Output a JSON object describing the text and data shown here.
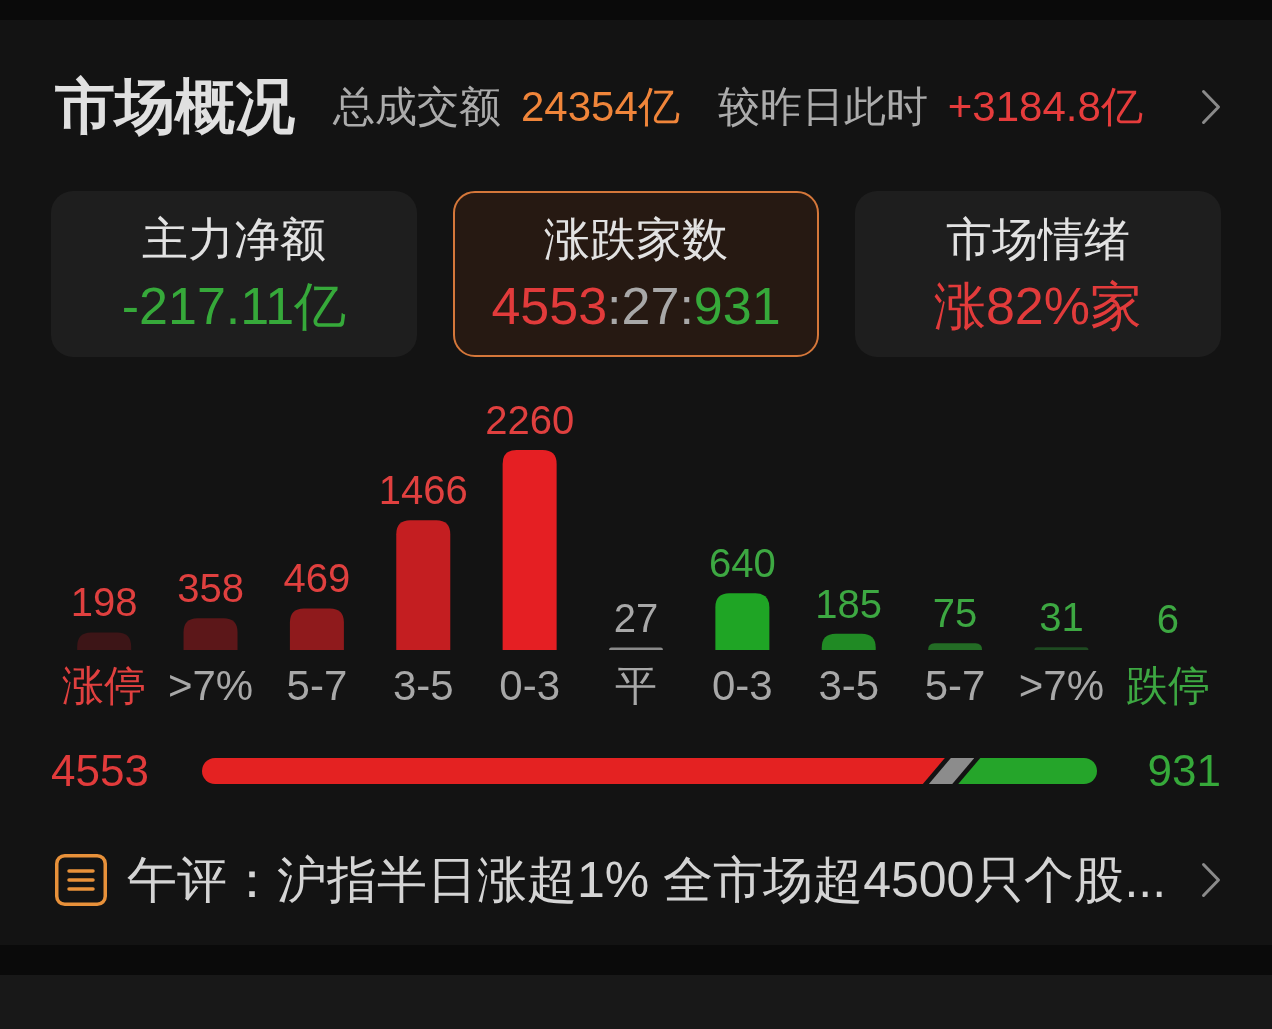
{
  "header": {
    "title": "市场概况",
    "items": [
      {
        "kind": "label",
        "text": "总成交额"
      },
      {
        "kind": "amount",
        "text": "24354亿"
      },
      {
        "kind": "label",
        "text": "较昨日此时"
      },
      {
        "kind": "up",
        "text": "+3184.8亿"
      }
    ]
  },
  "cards": [
    {
      "title": "主力净额",
      "selected": false,
      "value_parts": [
        {
          "kind": "down",
          "text": "-217.11亿"
        }
      ]
    },
    {
      "title": "涨跌家数",
      "selected": true,
      "value_parts": [
        {
          "kind": "up",
          "text": "4553"
        },
        {
          "kind": "sep",
          "text": ":"
        },
        {
          "kind": "flat",
          "text": "27"
        },
        {
          "kind": "sep",
          "text": ":"
        },
        {
          "kind": "down",
          "text": "931"
        }
      ]
    },
    {
      "title": "市场情绪",
      "selected": false,
      "value_parts": [
        {
          "kind": "up",
          "text": "涨82%家"
        }
      ]
    }
  ],
  "distribution": {
    "chart_data": {
      "type": "bar",
      "categories": [
        "涨停",
        ">7%",
        "5-7",
        "3-5",
        "0-3",
        "平",
        "0-3",
        "3-5",
        "5-7",
        ">7%",
        "跌停"
      ],
      "values": [
        198,
        358,
        469,
        1466,
        2260,
        27,
        640,
        185,
        75,
        31,
        6
      ],
      "data_labels": true
    },
    "bars": [
      {
        "kind": "limit_up",
        "color": "#3d1517"
      },
      {
        "kind": "up",
        "color": "#5c1719"
      },
      {
        "kind": "up",
        "color": "#8f1a1c"
      },
      {
        "kind": "up",
        "color": "#c41e21"
      },
      {
        "kind": "up",
        "color": "#e51f23"
      },
      {
        "kind": "flat",
        "color": "#8a8a8a"
      },
      {
        "kind": "down",
        "color": "#1fa525"
      },
      {
        "kind": "down",
        "color": "#208a24"
      },
      {
        "kind": "down",
        "color": "#236c25"
      },
      {
        "kind": "down",
        "color": "#1e4a21"
      },
      {
        "kind": "limit_down"
      }
    ]
  },
  "ratio": {
    "up_count": "4553",
    "down_count": "931",
    "segments": [
      {
        "kind": "up",
        "level": 0.83
      },
      {
        "kind": "flat"
      },
      {
        "kind": "down",
        "level": 0.155
      }
    ]
  },
  "news": {
    "text": "午评：沪指半日涨超1% 全市场超4500只个股..."
  }
}
